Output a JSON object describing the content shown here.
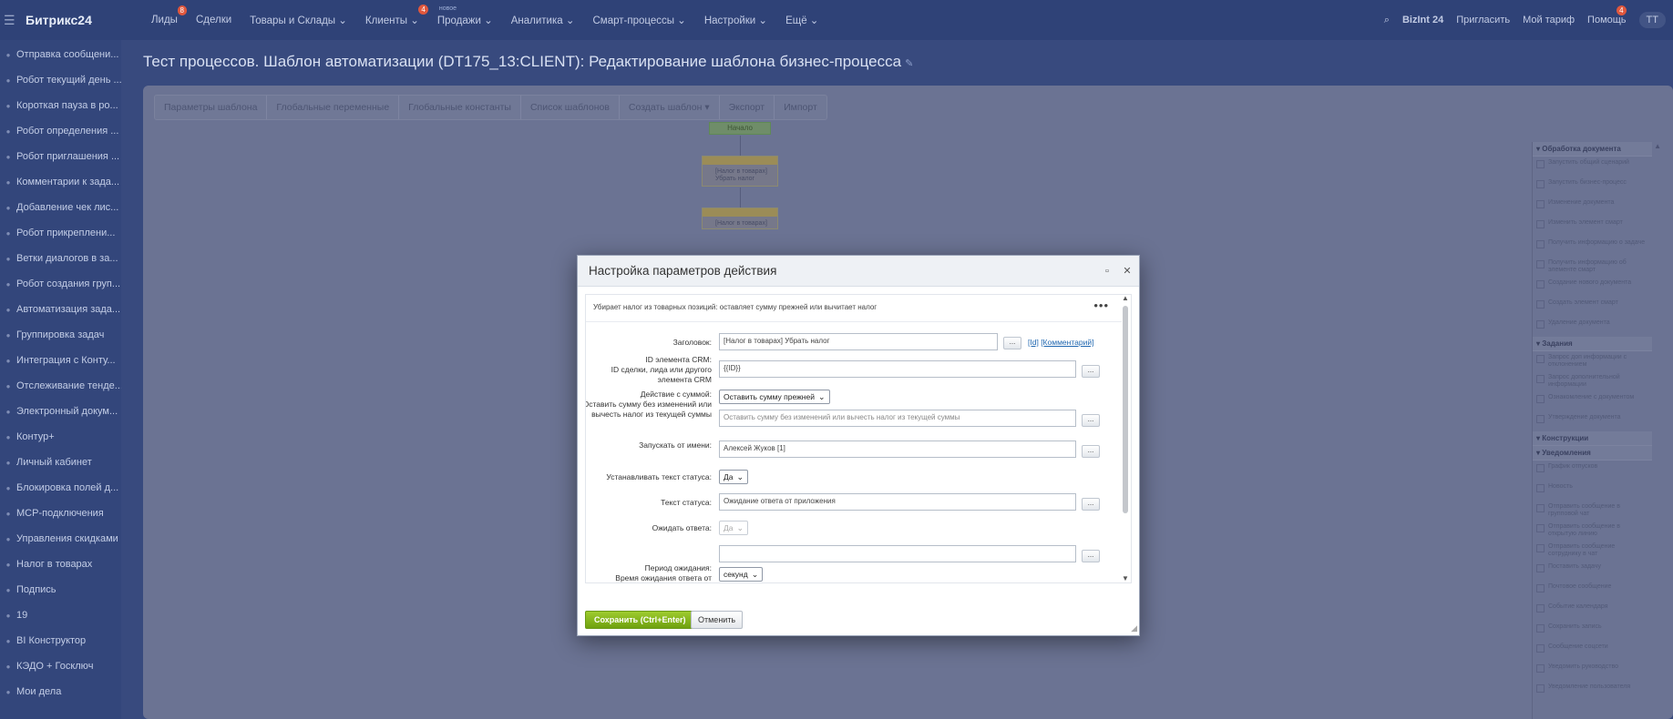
{
  "topbar": {
    "logo": "Битрикс24",
    "nav": [
      {
        "label": "Лиды",
        "badge": "8"
      },
      {
        "label": "Сделки",
        "badge": ""
      },
      {
        "label": "Товары и Склады ⌄",
        "badge": ""
      },
      {
        "label": "Клиенты ⌄",
        "badge": "4"
      },
      {
        "label": "Продажи ⌄",
        "badge": "",
        "new_tag": "новое"
      },
      {
        "label": "Аналитика ⌄",
        "badge": ""
      },
      {
        "label": "Смарт-процессы ⌄",
        "badge": ""
      },
      {
        "label": "Настройки ⌄",
        "badge": ""
      },
      {
        "label": "Ещё ⌄",
        "badge": ""
      }
    ],
    "company": "BizInt 24",
    "invite": "Пригласить",
    "tariff": "Мой тариф",
    "help": "Помощь",
    "help_badge": "4",
    "user_pill": "ТТ"
  },
  "sidebar": {
    "items": [
      "Отправка сообщени...",
      "Робот текущий день ...",
      "Короткая пауза в ро...",
      "Робот определения ...",
      "Робот приглашения ...",
      "Комментарии к зада...",
      "Добавление чек лис...",
      "Робот прикреплени...",
      "Ветки диалогов в за...",
      "Робот создания груп...",
      "Автоматизация зада...",
      "Группировка задач",
      "Интеграция с Конту...",
      "Отслеживание тенде...",
      "Электронный докум...",
      "Контур+",
      "Личный кабинет",
      "Блокировка полей д...",
      "МСР-подключения",
      "Управления скидками",
      "Налог в товарах",
      "Подпись",
      "19",
      "BI Конструктор",
      "КЭДО + Госключ",
      "Мои дела"
    ]
  },
  "page": {
    "title": "Тест процессов. Шаблон автоматизации (DT175_13:CLIENT): Редактирование шаблона бизнес-процесса",
    "tabs": [
      "Параметры шаблона",
      "Глобальные переменные",
      "Глобальные константы",
      "Список шаблонов",
      "Создать шаблон ▾",
      "Экспорт",
      "Импорт"
    ]
  },
  "flow": {
    "start": "Начало",
    "block1": "[Налог в товарах] Убрать налог",
    "block2": "[Налог в товарах]"
  },
  "right_panel": {
    "sections": [
      {
        "title": "Обработка документа",
        "items": [
          "Запустить общий сценарий",
          "Запустить бизнес-процесс",
          "Изменение документа",
          "Изменить элемент смарт",
          "Получить информацию о задаче",
          "Получить информацию об элементе смарт",
          "Создание нового документа",
          "Создать элемент смарт",
          "Удаление документа"
        ]
      },
      {
        "title": "Задания",
        "items": [
          "Запрос доп информации с отклонением",
          "Запрос дополнительной информации",
          "Ознакомление с документом",
          "Утверждение документа"
        ]
      },
      {
        "title": "Конструкции",
        "items": []
      },
      {
        "title": "Уведомления",
        "items": [
          "График отпусков",
          "Новость",
          "Отправить сообщение в групповой чат",
          "Отправить сообщение в открытую линию",
          "Отправить сообщение сотруднику в чат",
          "Поставить задачу",
          "Почтовое сообщение",
          "Событие календаря",
          "Сохранить запись",
          "Сообщение соцсети",
          "Уведомить руководство",
          "Уведомление пользователя"
        ]
      }
    ]
  },
  "dialog": {
    "title": "Настройка параметров действия",
    "description": "Убирает налог из товарных позиций: оставляет сумму прежней или вычитает налог",
    "links": {
      "id": "[Id]",
      "comment": "[Комментарий]"
    },
    "fields": {
      "title_label": "Заголовок:",
      "title_value": "[Налог в товарах] Убрать налог",
      "crm_label_1": "ID элемента CRM:",
      "crm_label_2": "ID сделки, лида или другого элемента CRM",
      "crm_value": "{{ID}}",
      "action_label_1": "Действие с суммой:",
      "action_label_2": "Оставить сумму без изменений или вычесть налог из текущей суммы",
      "action_select": "Оставить сумму прежней",
      "action_placeholder": "Оставить сумму без изменений или вычесть налог из текущей суммы",
      "run_as_label": "Запускать от имени:",
      "run_as_value": "Алексей Жуков [1]",
      "set_status_label": "Устанавливать текст статуса:",
      "set_status_value": "Да",
      "status_text_label": "Текст статуса:",
      "status_text_value": "Ожидание ответа от приложения",
      "wait_label": "Ожидать ответа:",
      "wait_value": "Да",
      "period_label_1": "Период ожидания:",
      "period_label_2": "Время ожидания ответа от",
      "period_value": "",
      "period_unit": "секунд"
    },
    "dots": "...",
    "save_button": "Сохранить (Ctrl+Enter)",
    "cancel_button": "Отменить"
  }
}
